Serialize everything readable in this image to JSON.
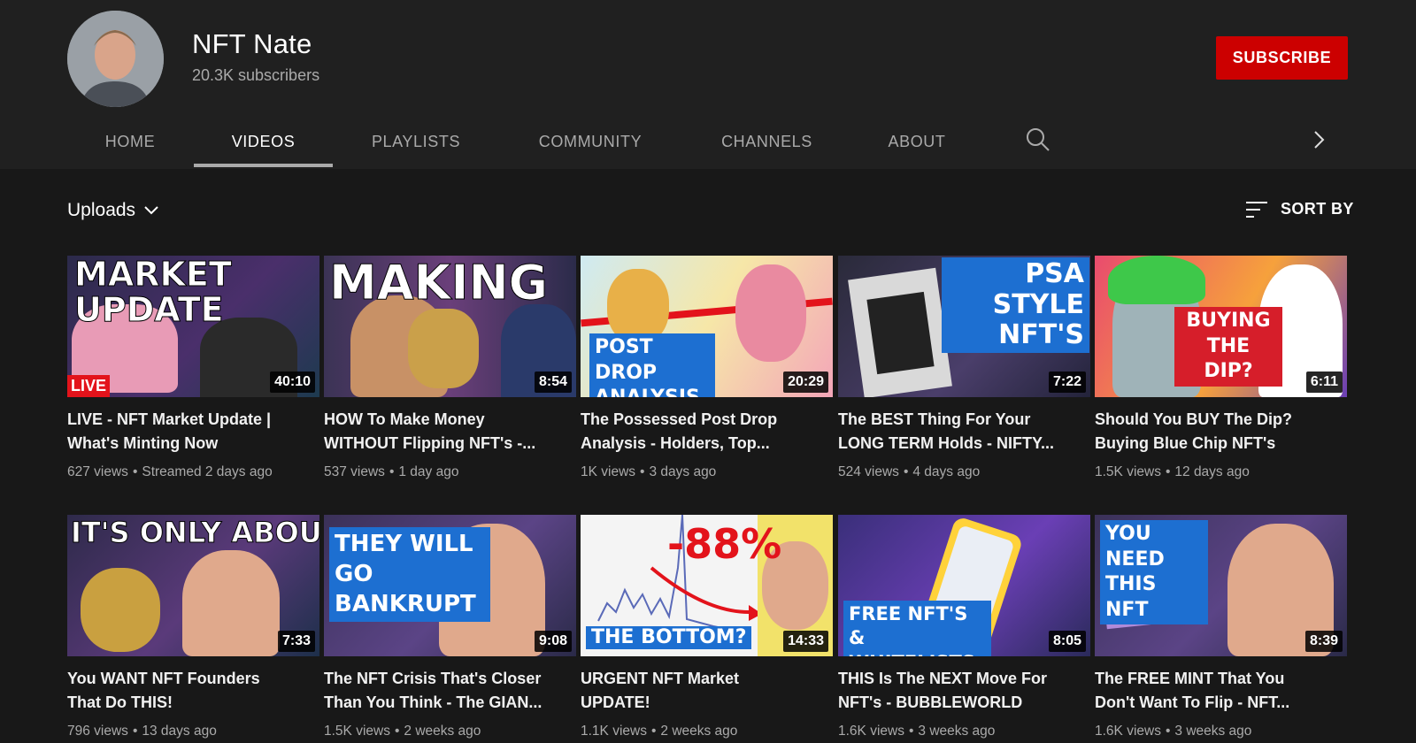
{
  "channel": {
    "name": "NFT Nate",
    "subscribers": "20.3K subscribers",
    "subscribe_label": "SUBSCRIBE"
  },
  "tabs": [
    {
      "label": "HOME",
      "active": false
    },
    {
      "label": "VIDEOS",
      "active": true
    },
    {
      "label": "PLAYLISTS",
      "active": false
    },
    {
      "label": "COMMUNITY",
      "active": false
    },
    {
      "label": "CHANNELS",
      "active": false
    },
    {
      "label": "ABOUT",
      "active": false
    }
  ],
  "toolbar": {
    "uploads_label": "Uploads",
    "sort_label": "SORT BY"
  },
  "videos": [
    {
      "title_line1": "LIVE - NFT Market Update |",
      "title_line2": "What's Minting Now",
      "views": "627 views",
      "age": "Streamed 2 days ago",
      "duration": "40:10",
      "thumb_text": "MARKET UPDATE",
      "badge": "LIVE"
    },
    {
      "title_line1": "HOW To Make Money",
      "title_line2": "WITHOUT Flipping NFT's -...",
      "views": "537 views",
      "age": "1 day ago",
      "duration": "8:54",
      "thumb_text": "MAKING"
    },
    {
      "title_line1": "The Possessed Post Drop",
      "title_line2": "Analysis - Holders, Top...",
      "views": "1K views",
      "age": "3 days ago",
      "duration": "20:29",
      "thumb_text": "POST DROP ANALYSIS"
    },
    {
      "title_line1": "The BEST Thing For Your",
      "title_line2": "LONG TERM Holds - NIFTY...",
      "views": "524 views",
      "age": "4 days ago",
      "duration": "7:22",
      "thumb_text": "PSA STYLE NFT'S"
    },
    {
      "title_line1": "Should You BUY The Dip?",
      "title_line2": "Buying Blue Chip NFT's",
      "views": "1.5K views",
      "age": "12 days ago",
      "duration": "6:11",
      "thumb_text": "BUYING THE DIP?"
    },
    {
      "title_line1": "You WANT NFT Founders",
      "title_line2": "That Do THIS!",
      "views": "796 views",
      "age": "13 days ago",
      "duration": "7:33",
      "thumb_text": "IT'S ONLY ABOUT"
    },
    {
      "title_line1": "The NFT Crisis That's Closer",
      "title_line2": "Than You Think - The GIAN...",
      "views": "1.5K views",
      "age": "2 weeks ago",
      "duration": "9:08",
      "thumb_text": "THEY WILL GO BANKRUPT"
    },
    {
      "title_line1": "URGENT NFT Market",
      "title_line2": "UPDATE!",
      "views": "1.1K views",
      "age": "2 weeks ago",
      "duration": "14:33",
      "thumb_text": "-88%",
      "thumb_text2": "THE BOTTOM?"
    },
    {
      "title_line1": "THIS Is The NEXT Move For",
      "title_line2": "NFT's - BUBBLEWORLD",
      "views": "1.6K views",
      "age": "3 weeks ago",
      "duration": "8:05",
      "thumb_text": "FREE NFT'S & WHITELISTS"
    },
    {
      "title_line1": "The FREE MINT That You",
      "title_line2": "Don't Want To Flip - NFT...",
      "views": "1.6K views",
      "age": "3 weeks ago",
      "duration": "8:39",
      "thumb_text": "YOU NEED THIS NFT"
    }
  ]
}
